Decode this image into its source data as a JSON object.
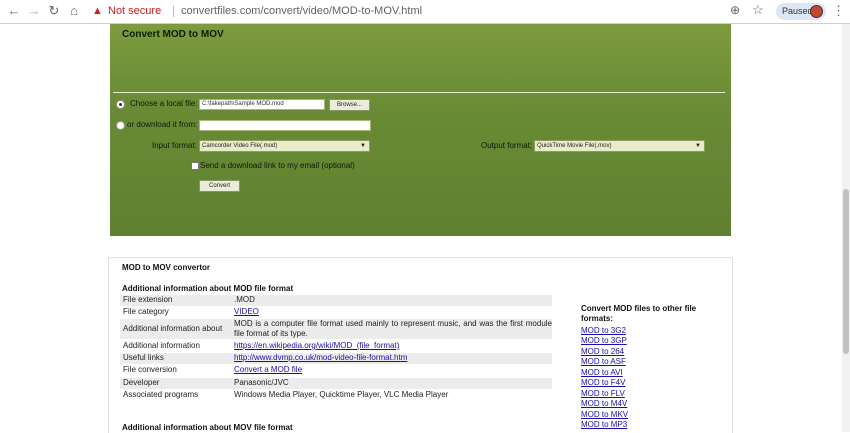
{
  "browser": {
    "security_label": "Not secure",
    "url": "convertfiles.com/convert/video/MOD-to-MOV.html",
    "profile_label": "Paused"
  },
  "converter": {
    "title": "Convert MOD to MOV",
    "choose_local_label": "Choose a local file:",
    "local_file_value": "C:\\fakepath\\Sample MOD.mod",
    "browse_label": "Browse...",
    "download_label": "or download it from:",
    "download_value": "",
    "input_format_label": "Input format:",
    "input_format_value": "Camcorder Video File(.mod)",
    "output_format_label": "Output format:",
    "output_format_value": "QuickTime Movie File(.mov)",
    "email_label": "Send a download link to my email (optional)",
    "convert_label": "Convert"
  },
  "info": {
    "title": "MOD to MOV convertor",
    "mod_section_title": "Additional information about MOD file format",
    "rows": [
      {
        "key": "File extension",
        "value": ".MOD"
      },
      {
        "key": "File category",
        "value": "VIDEO"
      },
      {
        "key": "Additional information about",
        "value": "MOD is a computer file format used mainly to represent music, and was the first module file format of its type."
      },
      {
        "key": "Additional information",
        "value": "https://en.wikipedia.org/wiki/MOD_(file_format)"
      },
      {
        "key": "Useful links",
        "value": "http://www.dvmp.co.uk/mod-video-file-format.htm"
      },
      {
        "key": "File conversion",
        "value": "Convert a MOD file"
      },
      {
        "key": "Developer",
        "value": "Panasonic/JVC"
      },
      {
        "key": "Associated programs",
        "value": "Windows Media Player, Quicktime Player, VLC Media Player"
      }
    ],
    "mov_section_title": "Additional information about MOV file format",
    "other_formats_title": "Convert MOD files to other file formats:",
    "other_links": [
      "MOD to 3G2",
      "MOD to 3GP",
      "MOD to 264",
      "MOD to ASF",
      "MOD to AVI",
      "MOD to F4V",
      "MOD to FLV",
      "MOD to M4V",
      "MOD to MKV",
      "MOD to MP3"
    ]
  }
}
